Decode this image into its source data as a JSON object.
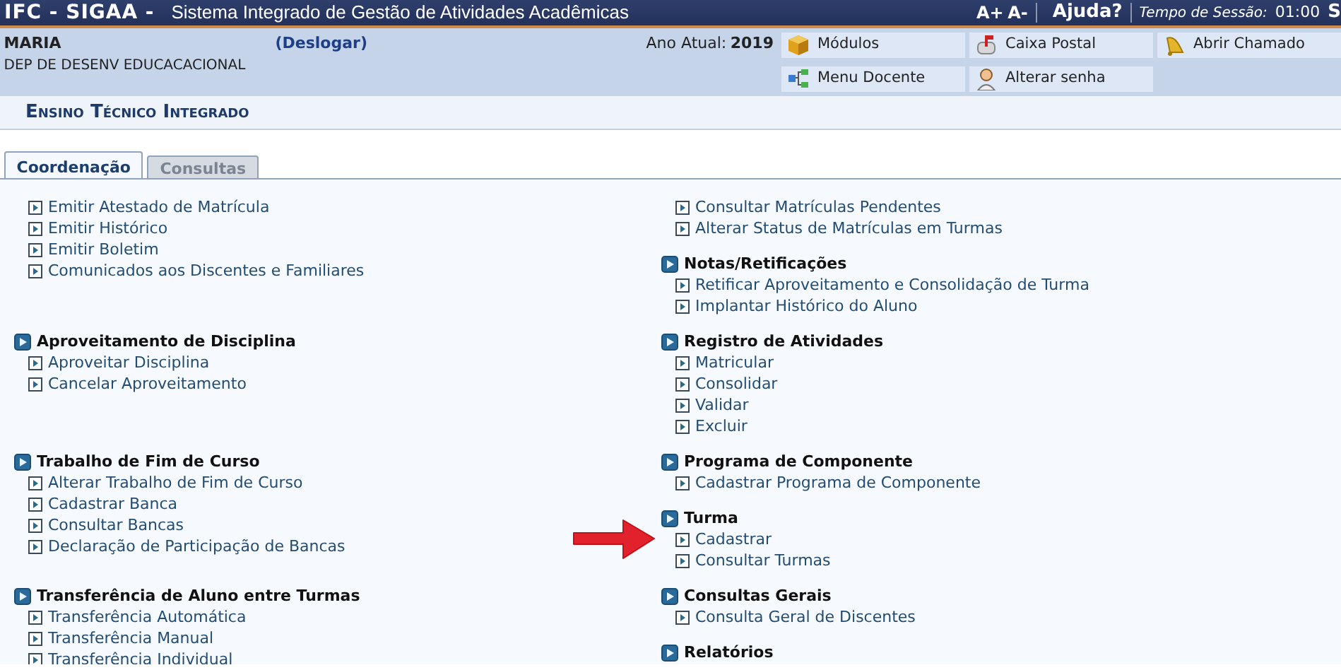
{
  "top_bar": {
    "system": "IFC - SIGAA -",
    "title": "Sistema Integrado de Gestão de Atividades Acadêmicas",
    "font_increase": "A+",
    "font_decrease": "A-",
    "help": "Ajuda?",
    "session_label": "Tempo de Sessão:",
    "session_time": "01:00",
    "cut_label": "S"
  },
  "user": {
    "name": "MARIA",
    "logout": "(Deslogar)",
    "unit": "DEP DE DESENV EDUCACACIONAL",
    "year_label": "Ano Atual:",
    "year": "2019"
  },
  "shortcuts": [
    {
      "label": "Módulos",
      "kind": "cube"
    },
    {
      "label": "Caixa Postal",
      "kind": "mailbox"
    },
    {
      "label": "Abrir Chamado",
      "kind": "bell"
    },
    {
      "label": "Menu Docente",
      "kind": "tree"
    },
    {
      "label": "Alterar senha",
      "kind": "person"
    }
  ],
  "module_title": "Ensino Técnico Integrado",
  "tabs": [
    {
      "label": "Coordenação",
      "selected": true
    },
    {
      "label": "Consultas",
      "selected": false
    }
  ],
  "rows": [
    {
      "left": [
        {
          "items": [
            {
              "label": "Emitir Atestado de Matrícula"
            },
            {
              "label": "Emitir Histórico"
            },
            {
              "label": "Emitir Boletim"
            },
            {
              "label": "Comunicados aos Discentes e Familiares"
            }
          ]
        }
      ],
      "right": [
        {
          "items": [
            {
              "label": "Consultar Matrículas Pendentes"
            },
            {
              "label": "Alterar Status de Matrículas em Turmas"
            }
          ]
        },
        {
          "title": "Notas/Retificações",
          "items": [
            {
              "label": "Retificar Aproveitamento e Consolidação de Turma"
            },
            {
              "label": "Implantar Histórico do Aluno"
            }
          ]
        }
      ]
    },
    {
      "left": [
        {
          "title": "Aproveitamento de Disciplina",
          "items": [
            {
              "label": "Aproveitar Disciplina"
            },
            {
              "label": "Cancelar Aproveitamento"
            }
          ]
        }
      ],
      "right": [
        {
          "title": "Registro de Atividades",
          "items": [
            {
              "label": "Matricular"
            },
            {
              "label": "Consolidar"
            },
            {
              "label": "Validar"
            },
            {
              "label": "Excluir"
            }
          ]
        }
      ]
    },
    {
      "left": [
        {
          "title": "Trabalho de Fim de Curso",
          "items": [
            {
              "label": "Alterar Trabalho de Fim de Curso"
            },
            {
              "label": "Cadastrar Banca"
            },
            {
              "label": "Consultar Bancas"
            },
            {
              "label": "Declaração de Participação de Bancas"
            }
          ]
        }
      ],
      "right": [
        {
          "title": "Programa de Componente",
          "items": [
            {
              "label": "Cadastrar Programa de Componente"
            }
          ]
        },
        {
          "title": "Turma",
          "items": [
            {
              "label": "Cadastrar",
              "highlighted": true
            },
            {
              "label": "Consultar Turmas"
            }
          ]
        }
      ]
    },
    {
      "left": [
        {
          "title": "Transferência de Aluno entre Turmas",
          "items": [
            {
              "label": "Transferência Automática"
            },
            {
              "label": "Transferência Manual"
            },
            {
              "label": "Transferência Individual"
            }
          ]
        }
      ],
      "right": [
        {
          "title": "Consultas Gerais",
          "items": [
            {
              "label": "Consulta Geral de Discentes"
            }
          ]
        },
        {
          "title": "Relatórios"
        }
      ]
    }
  ]
}
